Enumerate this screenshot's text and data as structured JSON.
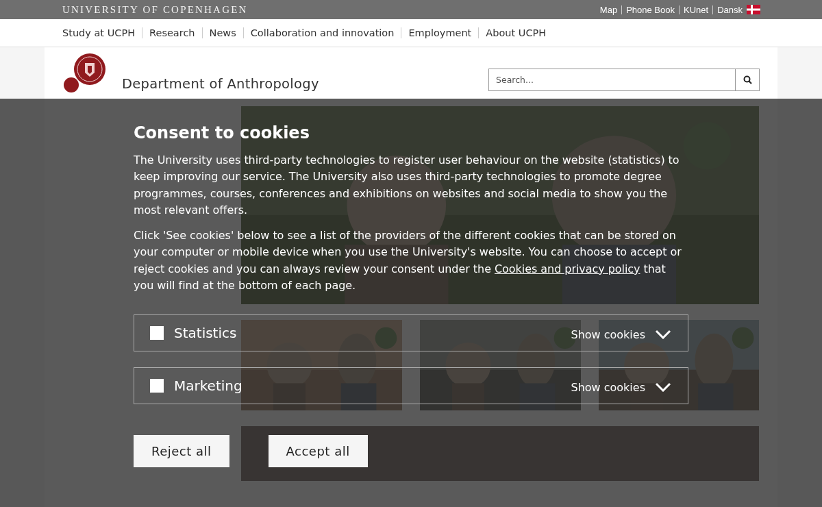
{
  "top_bar": {
    "title": "UNIVERSITY OF COPENHAGEN",
    "links": [
      "Map",
      "Phone Book",
      "KUnet",
      "Dansk"
    ]
  },
  "main_nav": [
    "Study at UCPH",
    "Research",
    "News",
    "Collaboration and innovation",
    "Employment",
    "About UCPH"
  ],
  "header": {
    "department": "Department of Anthropology",
    "search": {
      "placeholder": "Search..."
    }
  },
  "cookie_dialog": {
    "title": "Consent to cookies",
    "paragraph_1": "The University uses third-party technologies to register user behaviour on the website (statistics) to keep improving our service. The University also uses third-party technologies to promote degree programmes, courses, conferences and exhibitions on websites and social media to show you the most relevant offers.",
    "paragraph_2": {
      "before": "Click 'See cookies' below to see a list of the providers of the different cookies that can be stored on your computer or mobile device when you use the University's website. You can choose to accept or reject cookies and you can always review your consent under the",
      "link": "Cookies and privacy policy",
      "after": "that you will find at the bottom of each page."
    },
    "categories": [
      {
        "label": "Statistics",
        "checked": false,
        "action": "Show cookies"
      },
      {
        "label": "Marketing",
        "checked": false,
        "action": "Show cookies"
      }
    ],
    "buttons": [
      "Reject all",
      "Accept all"
    ]
  }
}
